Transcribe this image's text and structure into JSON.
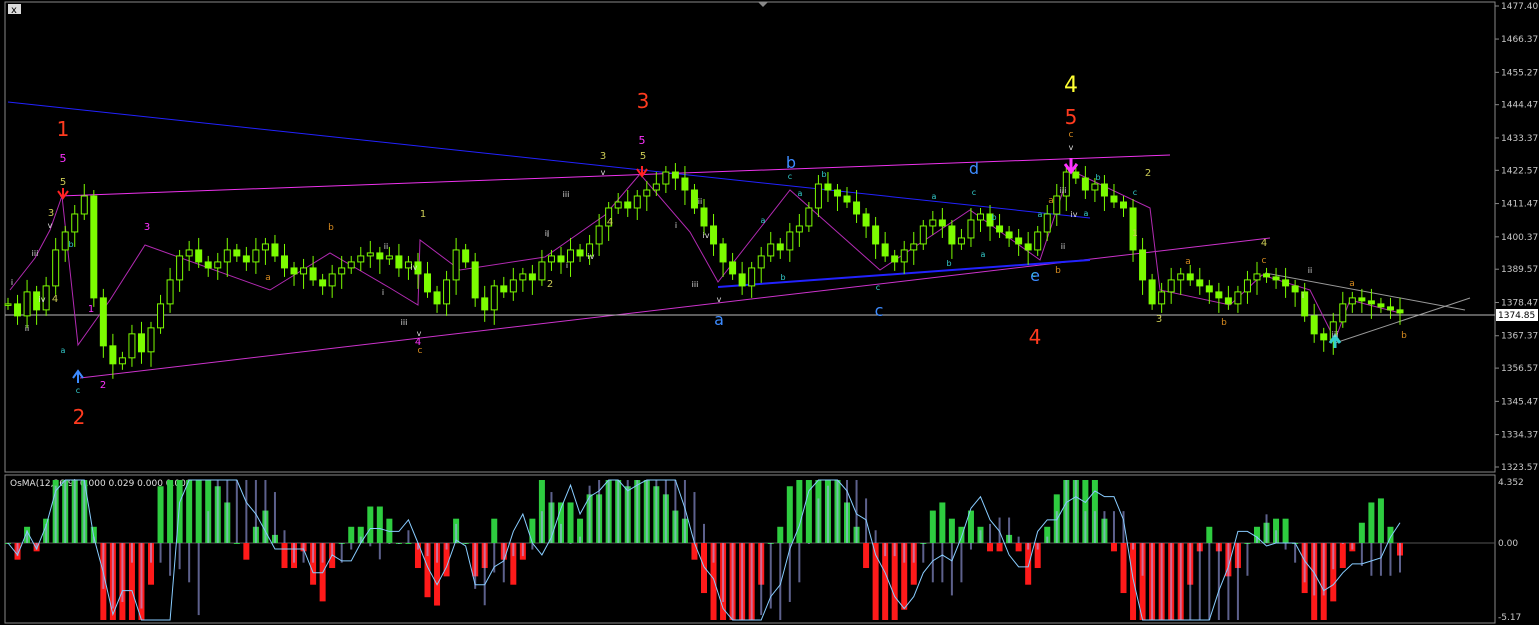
{
  "window": {
    "close_glyph": "x"
  },
  "price_axis": {
    "ticks": [
      "1477.40",
      "1466.37",
      "1455.27",
      "1444.47",
      "1433.37",
      "1422.57",
      "1411.47",
      "1400.37",
      "1389.57",
      "1378.47",
      "1367.37",
      "1356.57",
      "1345.47",
      "1334.37",
      "1323.57"
    ],
    "current_price": "1374.85"
  },
  "indicator": {
    "title": "OsMA(12,26,9) 0.000 0.029 0.000 0.000",
    "axis_ticks": [
      "4.352",
      "0.00",
      "-5.17"
    ]
  },
  "colors": {
    "background": "#000000",
    "candle": "#7cfc00",
    "primary_wave": "#ff3b1f",
    "wave4_top": "#ffff33",
    "minor_wave": "#ff33ff",
    "subwave_olive": "#cccc55",
    "subwave_orange": "#d68a1f",
    "abcde": "#3d8bff",
    "abc_small": "#33cccc",
    "roman": "#dddddd",
    "upper_trendline": "#ee33ee",
    "lower_trendline": "#cc33cc",
    "blue_trendline": "#2222ff",
    "osma_pos": "#2ecc40",
    "osma_neg": "#ff1a1a",
    "macd_hatch": "#aab0ff",
    "signal_line": "#88ccff"
  },
  "chart_data": {
    "type": "candlestick",
    "ylim": [
      1323.57,
      1477.4
    ],
    "closes": [
      1378,
      1374,
      1382,
      1376,
      1384,
      1396,
      1402,
      1408,
      1414,
      1380,
      1364,
      1358,
      1360,
      1368,
      1362,
      1370,
      1378,
      1386,
      1394,
      1396,
      1392,
      1390,
      1392,
      1396,
      1394,
      1392,
      1396,
      1398,
      1394,
      1390,
      1388,
      1390,
      1386,
      1384,
      1388,
      1390,
      1392,
      1394,
      1395,
      1393,
      1394,
      1390,
      1392,
      1388,
      1382,
      1378,
      1386,
      1396,
      1392,
      1380,
      1376,
      1384,
      1382,
      1386,
      1388,
      1386,
      1392,
      1394,
      1392,
      1396,
      1394,
      1398,
      1404,
      1410,
      1412,
      1410,
      1414,
      1416,
      1418,
      1422,
      1420,
      1416,
      1410,
      1404,
      1398,
      1392,
      1388,
      1384,
      1390,
      1394,
      1398,
      1396,
      1402,
      1404,
      1410,
      1418,
      1416,
      1414,
      1412,
      1408,
      1404,
      1398,
      1394,
      1392,
      1396,
      1398,
      1404,
      1406,
      1404,
      1398,
      1400,
      1406,
      1408,
      1404,
      1402,
      1400,
      1398,
      1396,
      1402,
      1408,
      1414,
      1422,
      1420,
      1416,
      1418,
      1414,
      1412,
      1410,
      1396,
      1386,
      1378,
      1382,
      1386,
      1388,
      1386,
      1384,
      1382,
      1380,
      1378,
      1382,
      1386,
      1388,
      1387,
      1386,
      1384,
      1382,
      1374,
      1368,
      1366,
      1372,
      1378,
      1380,
      1379,
      1378,
      1377,
      1376,
      1375
    ],
    "wave_labels": {
      "primary": [
        "1",
        "2",
        "3",
        "4",
        "5",
        "4"
      ],
      "top": [
        "4"
      ],
      "abcde": [
        "a",
        "b",
        "c",
        "d",
        "e"
      ],
      "roman": [
        "i",
        "ii",
        "iii",
        "iv",
        "v"
      ]
    },
    "osma": {
      "ylim": [
        -5.17,
        4.352
      ]
    }
  }
}
